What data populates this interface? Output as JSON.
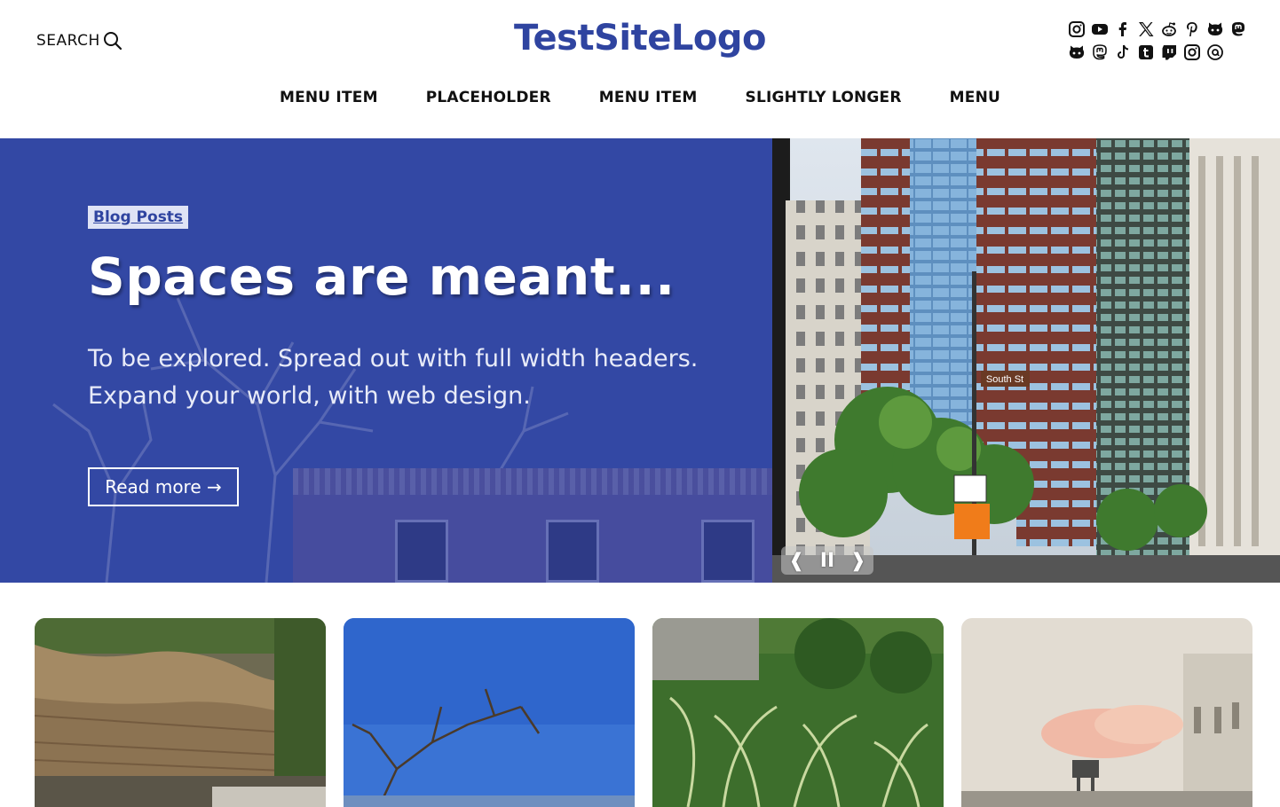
{
  "header": {
    "search_label": "SEARCH",
    "logo": "TestSiteLogo",
    "social_row1": [
      "instagram-icon",
      "youtube-icon",
      "facebook-icon",
      "x-icon",
      "reddit-icon",
      "pinterest-icon",
      "github-icon",
      "mastodon-icon"
    ],
    "social_row2": [
      "github-icon",
      "mastodon-icon",
      "tiktok-icon",
      "tumblr-icon",
      "twitch-icon",
      "instagram-icon",
      "threads-icon"
    ]
  },
  "nav": {
    "items": [
      "MENU ITEM",
      "PLACEHOLDER",
      "MENU ITEM",
      "SLIGHTLY LONGER",
      "MENU"
    ]
  },
  "hero": {
    "badge": "Blog Posts",
    "title": "Spaces are meant...",
    "text": "To be explored. Spread out with full width headers. Expand your world, with web design.",
    "read_more": "Read more →",
    "controls": {
      "prev": "❰",
      "pause": "II",
      "next": "❱"
    },
    "street_sign": "South St"
  },
  "colors": {
    "brand": "#2f44a0",
    "hero_bg": "#3348a4"
  },
  "cards": [
    {
      "icon": "cliff-beach-photo"
    },
    {
      "icon": "bare-tree-sky-photo"
    },
    {
      "icon": "plants-photo"
    },
    {
      "icon": "sunset-buildings-photo"
    }
  ]
}
